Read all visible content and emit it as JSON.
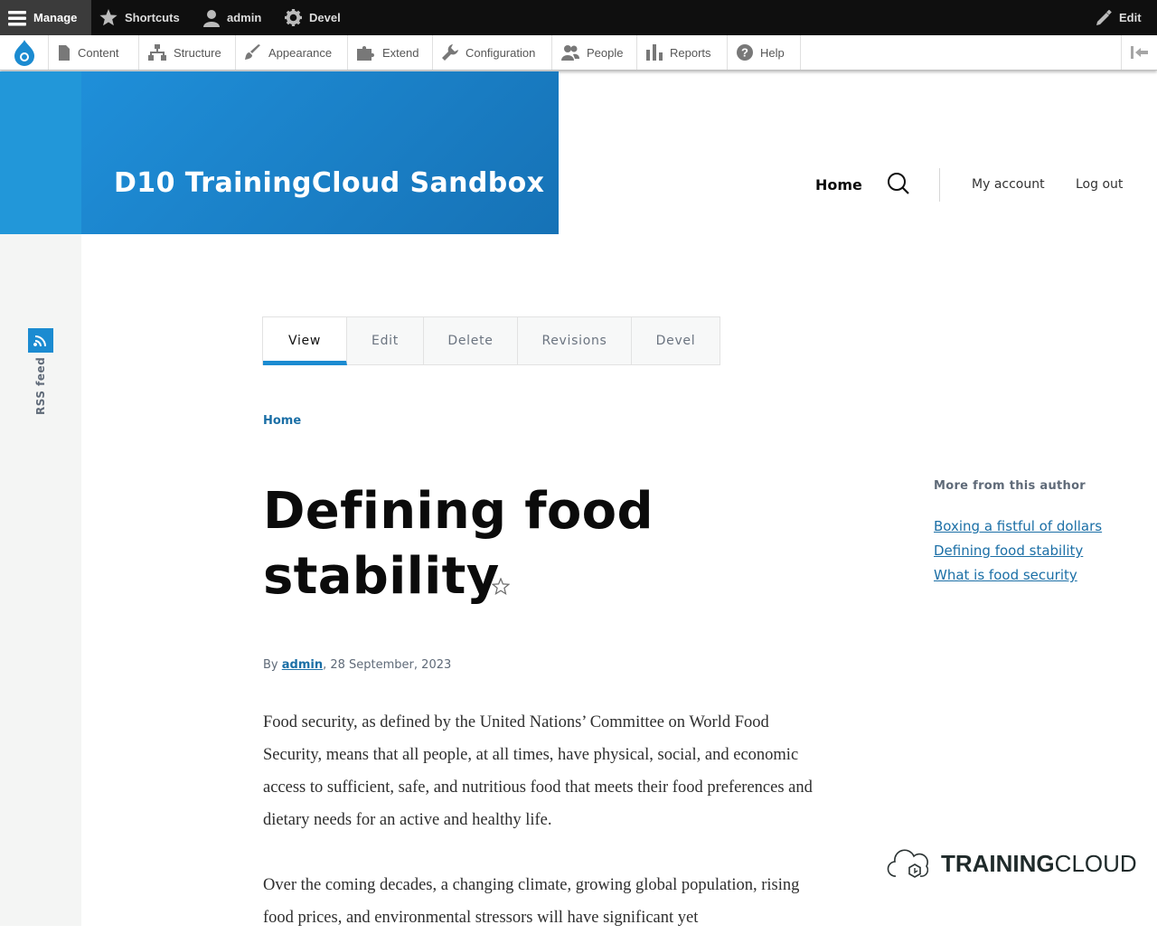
{
  "toolbar": {
    "manage": "Manage",
    "shortcuts": "Shortcuts",
    "user": "admin",
    "devel": "Devel",
    "edit": "Edit"
  },
  "tray": {
    "items": [
      "Content",
      "Structure",
      "Appearance",
      "Extend",
      "Configuration",
      "People",
      "Reports",
      "Help"
    ]
  },
  "site": {
    "name": "D10 TrainingCloud Sandbox"
  },
  "nav": {
    "home": "Home",
    "my_account": "My account",
    "log_out": "Log out"
  },
  "sidebar": {
    "rss": "RSS feed"
  },
  "tabs": {
    "items": [
      "View",
      "Edit",
      "Delete",
      "Revisions",
      "Devel"
    ],
    "active": "View"
  },
  "breadcrumb": {
    "home": "Home"
  },
  "article": {
    "title_line1": "Defining food",
    "title_line2": "stability",
    "by": "By",
    "author": "admin",
    "date": ", 28 September, 2023",
    "paragraph1": "Food security, as defined by the United Nations’ Committee on World Food Security, means that all people, at all times, have physical, social, and economic access to sufficient, safe, and nutritious food that meets their food preferences and dietary needs for an active and healthy life.",
    "paragraph2": "Over the coming decades, a changing climate, growing global population, rising food prices, and environmental stressors will have significant yet"
  },
  "block": {
    "title": "More from this author",
    "links": [
      "Boxing a fistful of dollars",
      "Defining food stability",
      "What is food security"
    ]
  },
  "logo": {
    "bold": "TRAINING",
    "light": "CLOUD"
  },
  "colors": {
    "toolbar_bg": "#0f0f0f",
    "brand_blue": "#1b8bd1",
    "link": "#1b6fa6"
  }
}
